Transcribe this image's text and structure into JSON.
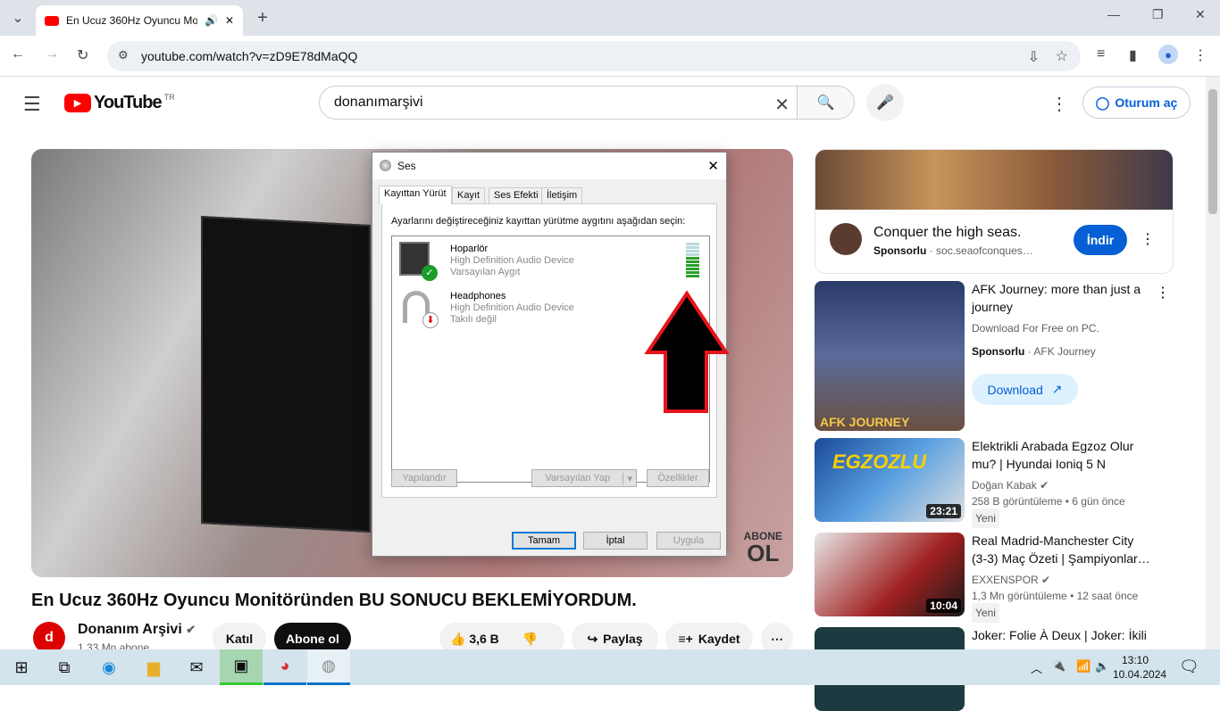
{
  "browser": {
    "tab_title": "En Ucuz 360Hz Oyuncu Monitöründen BU SONUCU BEKLEMİYORDUM.",
    "url": "youtube.com/watch?v=zD9E78dMaQQ"
  },
  "youtube": {
    "logo": "YouTube",
    "region": "TR",
    "search_value": "donanımarşivi",
    "signin": "Oturum aç"
  },
  "video": {
    "title": "En Ucuz 360Hz Oyuncu Monitöründen BU SONUCU BEKLEMİYORDUM.",
    "overlay_line1": "ABONE",
    "overlay_line2": "OL",
    "channel": "Donanım Arşivi",
    "subs": "1,33 Mn abone",
    "join": "Katıl",
    "subscribe": "Abone ol",
    "likes": "3,6 B",
    "share": "Paylaş",
    "save": "Kaydet"
  },
  "dialog": {
    "title": "Ses",
    "tabs": [
      "Kayıttan Yürüt",
      "Kayıt",
      "Ses Efekti",
      "İletişim"
    ],
    "instruction": "Ayarlarını değiştireceğiniz kayıttan yürütme aygıtını aşağıdan seçin:",
    "devices": [
      {
        "name": "Hoparlör",
        "desc": "High Definition Audio Device",
        "status": "Varsayılan Aygıt"
      },
      {
        "name": "Headphones",
        "desc": "High Definition Audio Device",
        "status": "Takılı değil"
      }
    ],
    "level_fraction": 0.6,
    "configure": "Yapılandır",
    "set_default": "Varsayılan Yap",
    "properties": "Özellikler",
    "ok": "Tamam",
    "cancel": "İptal",
    "apply": "Uygula"
  },
  "sidebar": {
    "ad": {
      "title": "Conquer the high seas.",
      "sponsored": "Sponsorlu",
      "domain": "soc.seaofconques…",
      "cta": "İndir"
    },
    "ad2": {
      "title": "AFK Journey: more than just a journey",
      "desc": "Download For Free on PC.",
      "sponsored": "Sponsorlu",
      "advertiser": "AFK Journey",
      "cta": "Download",
      "thumb_text": "AFK JOURNEY"
    },
    "videos": [
      {
        "title": "Elektrikli Arabada Egzoz Olur mu? | Hyundai Ioniq 5 N",
        "channel": "Doğan Kabak",
        "views": "258 B görüntüleme",
        "age": "6 gün önce",
        "badge": "Yeni",
        "duration": "23:21",
        "thumb_text": "EGZOZLU"
      },
      {
        "title": "Real Madrid-Manchester City (3-3) Maç Özeti | Şampiyonlar…",
        "channel": "EXXENSPOR",
        "views": "1,3 Mn görüntüleme",
        "age": "12 saat önce",
        "badge": "Yeni",
        "duration": "10:04"
      },
      {
        "title": "Joker: Folie À Deux | Joker: İkili"
      }
    ]
  },
  "taskbar": {
    "time": "13:10",
    "date": "10.04.2024"
  }
}
